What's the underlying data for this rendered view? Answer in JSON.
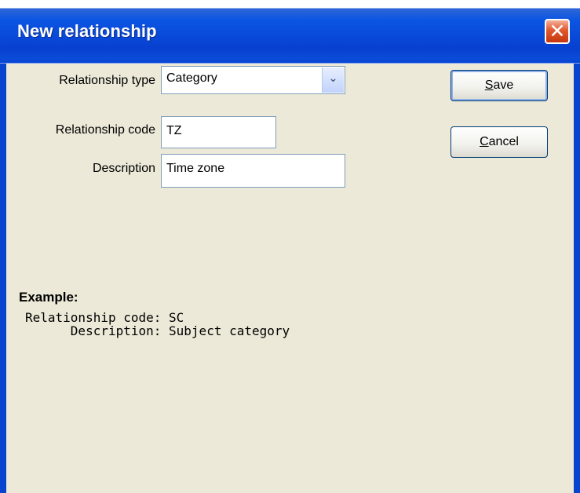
{
  "window": {
    "title": "New relationship",
    "close_glyph": "✕"
  },
  "form": {
    "relationship_type_label": "Relationship type",
    "relationship_type_value": "Category",
    "relationship_code_label": "Relationship code",
    "relationship_code_value": "TZ",
    "description_label": "Description",
    "description_value": "Time zone"
  },
  "buttons": {
    "save_label": "Save",
    "save_mnemonic": "S",
    "save_rest": "ave",
    "cancel_label": "Cancel",
    "cancel_mnemonic": "C",
    "cancel_rest": "ancel"
  },
  "example": {
    "title": "Example:",
    "line1": "Relationship code: SC",
    "line2": "      Description: Subject category"
  },
  "colors": {
    "titlebar": "#0a4bd8",
    "client_bg": "#ece9d8",
    "close_button": "#e2582e"
  }
}
